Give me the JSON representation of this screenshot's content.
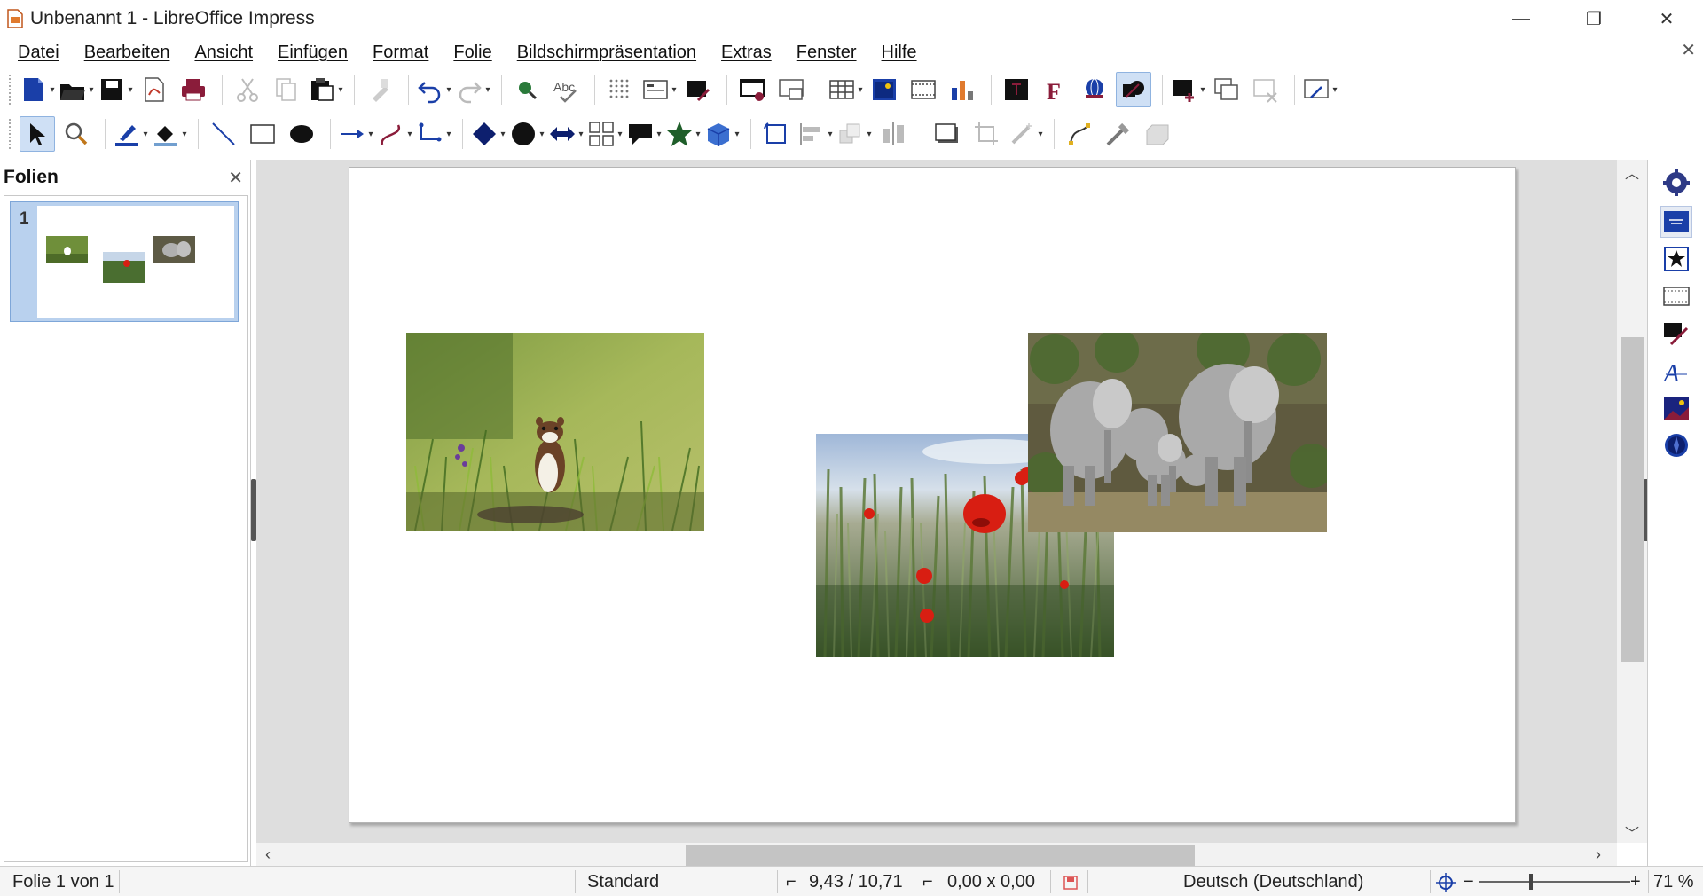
{
  "window": {
    "title": "Unbenannt 1 - LibreOffice Impress",
    "minimize": "—",
    "restore": "❐",
    "close": "✕"
  },
  "menu": {
    "items": [
      "Datei",
      "Bearbeiten",
      "Ansicht",
      "Einfügen",
      "Format",
      "Folie",
      "Bildschirmpräsentation",
      "Extras",
      "Fenster",
      "Hilfe"
    ],
    "close_doc": "✕"
  },
  "toolbar1": {
    "icons": [
      "new-icon",
      "open-icon",
      "save-icon",
      "export-pdf-icon",
      "print-icon",
      "cut-icon",
      "copy-icon",
      "paste-icon",
      "clone-formatting-icon",
      "undo-icon",
      "redo-icon",
      "find-icon",
      "spelling-icon",
      "grid-icon",
      "display-views-icon",
      "master-slides-icon",
      "start-first-slide-icon",
      "start-current-slide-icon",
      "table-icon",
      "image-icon",
      "media-icon",
      "chart-icon",
      "textbox-icon",
      "fontwork-icon",
      "hyperlink-icon",
      "show-draw-functions-icon",
      "new-slide-icon",
      "duplicate-slide-icon",
      "delete-slide-icon",
      "slide-layout-icon"
    ]
  },
  "toolbar2": {
    "icons": [
      "select-icon",
      "zoom-pan-icon",
      "line-color-icon",
      "fill-color-icon",
      "line-icon",
      "rectangle-icon",
      "ellipse-icon",
      "arrow-line-icon",
      "curve-icon",
      "connector-icon",
      "basic-shapes-icon",
      "symbol-shapes-icon",
      "block-arrows-icon",
      "flowchart-icon",
      "callouts-icon",
      "stars-icon",
      "3d-objects-icon",
      "rotate-icon",
      "align-icon",
      "arrange-icon",
      "distribute-icon",
      "shadow-icon",
      "crop-icon",
      "filter-icon",
      "points-icon",
      "glue-points-icon",
      "toggle-extrusion-icon"
    ]
  },
  "slides_pane": {
    "title": "Folien",
    "close": "✕",
    "slides": [
      {
        "number": "1"
      }
    ]
  },
  "slide": {
    "images": [
      "stoat-in-grass",
      "poppies-in-wheat-field",
      "elephant-family"
    ]
  },
  "sidebar": {
    "icons": [
      "properties-icon",
      "slide-transition-icon",
      "animation-icon",
      "master-slides-icon",
      "style-icon",
      "gallery-icon",
      "navigator-icon",
      "shapes-icon"
    ]
  },
  "statusbar": {
    "slide_info": "Folie 1 von 1",
    "master": "Standard",
    "position": "9,43 / 10,71",
    "size": "0,00 x 0,00",
    "language": "Deutsch (Deutschland)",
    "zoom_minus": "−",
    "zoom_plus": "+",
    "zoom": "71 %"
  },
  "colors": {
    "accent": "#1a3fa8",
    "selection": "#b9d1ee",
    "canvas_bg": "#dedede"
  }
}
